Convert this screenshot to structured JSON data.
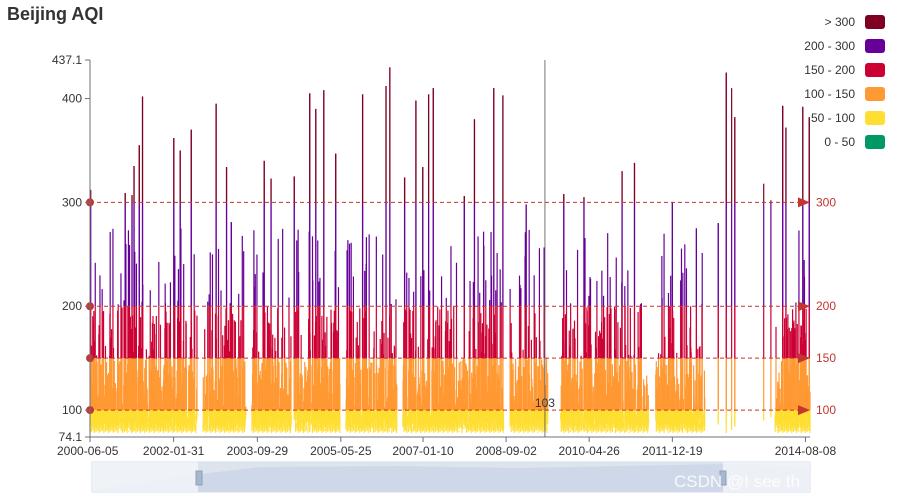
{
  "chart_data": {
    "type": "line",
    "title": "Beijing AQI",
    "x_dates": [
      "2000-06-05",
      "2002-01-31",
      "2003-09-29",
      "2005-05-25",
      "2007-01-10",
      "2008-09-02",
      "2010-04-26",
      "2011-12-19",
      "2014-08-08"
    ],
    "y_ticks": [
      {
        "label": "74.1",
        "value": 74.1
      },
      {
        "label": "100",
        "value": 100
      },
      {
        "label": "200",
        "value": 200
      },
      {
        "label": "300",
        "value": 300
      },
      {
        "label": "400",
        "value": 400
      },
      {
        "label": "437.1",
        "value": 437.1
      }
    ],
    "ylim": [
      74.1,
      437.1
    ],
    "xlim": [
      "2000-06-05",
      "2014-09-10"
    ],
    "pieces": [
      {
        "label": "> 300",
        "min": 300,
        "max": 1000,
        "color": "#7e0023"
      },
      {
        "label": "200 - 300",
        "min": 200,
        "max": 300,
        "color": "#660099"
      },
      {
        "label": "150 - 200",
        "min": 150,
        "max": 200,
        "color": "#cc0033"
      },
      {
        "label": "100 - 150",
        "min": 100,
        "max": 150,
        "color": "#ff9933"
      },
      {
        "label": "50 - 100",
        "min": 50,
        "max": 100,
        "color": "#ffde33"
      },
      {
        "label": "0 - 50",
        "min": 0,
        "max": 50,
        "color": "#096"
      }
    ],
    "mark_lines": [
      {
        "value": 100,
        "label": "100"
      },
      {
        "value": 150,
        "label": "150"
      },
      {
        "value": 200,
        "label": "200"
      },
      {
        "value": 300,
        "label": "300"
      }
    ],
    "cursor": {
      "date": "2009-06-10",
      "label": "103"
    },
    "peaks": [
      {
        "date": "2000-06-10",
        "value": 312
      },
      {
        "date": "2001-02-15",
        "value": 309
      },
      {
        "date": "2001-04-20",
        "value": 335
      },
      {
        "date": "2001-05-28",
        "value": 355
      },
      {
        "date": "2001-06-20",
        "value": 402
      },
      {
        "date": "2001-04-05",
        "value": 307
      },
      {
        "date": "2002-03-20",
        "value": 350
      },
      {
        "date": "2002-06-08",
        "value": 370
      },
      {
        "date": "2002-02-02",
        "value": 362
      },
      {
        "date": "2002-12-05",
        "value": 395
      },
      {
        "date": "2003-02-18",
        "value": 334
      },
      {
        "date": "2003-03-25",
        "value": 281
      },
      {
        "date": "2003-11-18",
        "value": 340
      },
      {
        "date": "2004-01-06",
        "value": 323
      },
      {
        "date": "2004-06-22",
        "value": 325
      },
      {
        "date": "2004-10-12",
        "value": 405
      },
      {
        "date": "2004-11-25",
        "value": 390
      },
      {
        "date": "2005-01-22",
        "value": 408
      },
      {
        "date": "2005-04-18",
        "value": 347
      },
      {
        "date": "2005-10-30",
        "value": 404
      },
      {
        "date": "2006-04-17",
        "value": 412
      },
      {
        "date": "2006-05-15",
        "value": 430
      },
      {
        "date": "2006-08-30",
        "value": 324
      },
      {
        "date": "2006-11-20",
        "value": 398
      },
      {
        "date": "2007-01-08",
        "value": 334
      },
      {
        "date": "2007-02-19",
        "value": 404
      },
      {
        "date": "2007-03-25",
        "value": 410
      },
      {
        "date": "2007-11-05",
        "value": 306
      },
      {
        "date": "2008-01-17",
        "value": 380
      },
      {
        "date": "2008-06-05",
        "value": 410
      },
      {
        "date": "2008-08-10",
        "value": 403
      },
      {
        "date": "2009-01-25",
        "value": 298
      },
      {
        "date": "2009-10-25",
        "value": 308
      },
      {
        "date": "2010-03-20",
        "value": 305
      },
      {
        "date": "2010-12-20",
        "value": 330
      },
      {
        "date": "2011-03-20",
        "value": 338
      },
      {
        "date": "2011-12-19",
        "value": 300
      },
      {
        "date": "2012-06-10",
        "value": 275
      },
      {
        "date": "2012-11-15",
        "value": 280
      },
      {
        "date": "2013-01-12",
        "value": 425
      },
      {
        "date": "2013-02-20",
        "value": 410
      },
      {
        "date": "2013-03-15",
        "value": 382
      },
      {
        "date": "2013-10-10",
        "value": 318
      },
      {
        "date": "2013-12-01",
        "value": 302
      },
      {
        "date": "2014-02-25",
        "value": 393
      },
      {
        "date": "2014-03-20",
        "value": 372
      },
      {
        "date": "2014-07-20",
        "value": 392
      },
      {
        "date": "2014-09-05",
        "value": 382
      }
    ]
  },
  "data_zoom": {
    "handle_label": "2000-06-05"
  },
  "watermark": "CSDN @I see th"
}
